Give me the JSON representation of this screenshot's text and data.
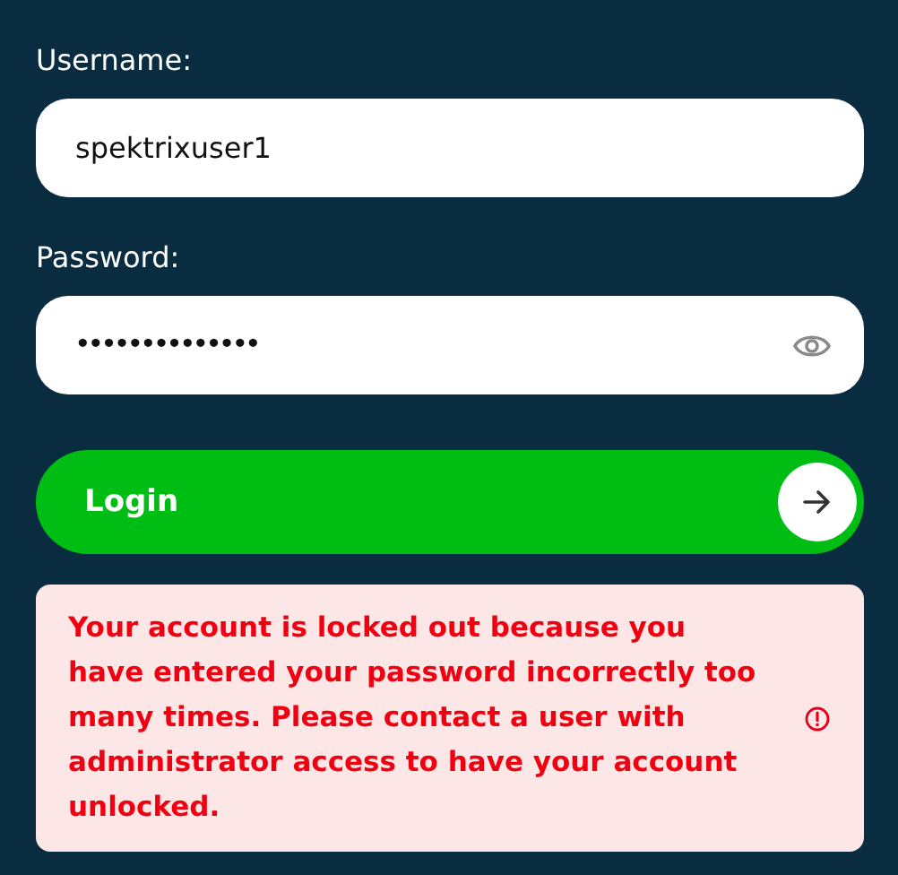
{
  "fields": [
    {
      "label": "Username:",
      "value": "spektrixuser1",
      "kind": "text"
    },
    {
      "label": "Password:",
      "value": "••••••••••••••",
      "kind": "password"
    }
  ],
  "login_button": {
    "label": "Login"
  },
  "error": {
    "message": "Your account is locked out because you have entered your password incorrectly too many times. Please contact a user with administrator access to have your account unlocked."
  }
}
